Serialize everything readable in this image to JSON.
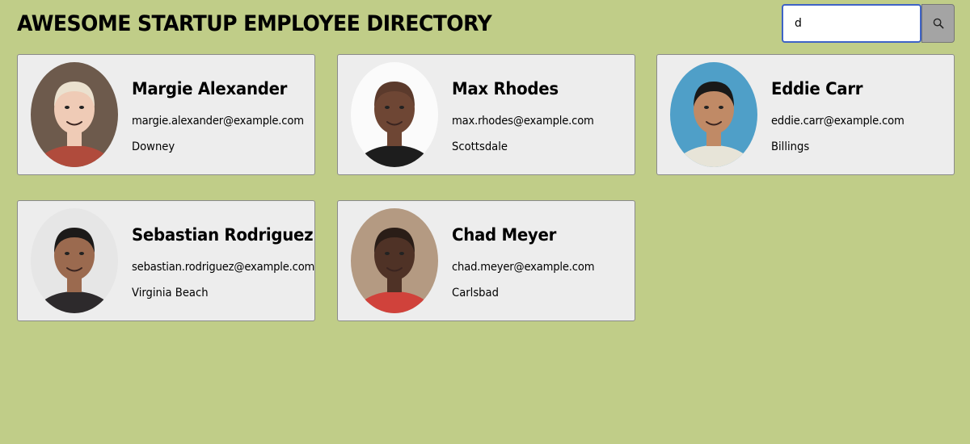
{
  "header": {
    "title": "AWESOME STARTUP EMPLOYEE DIRECTORY"
  },
  "search": {
    "value": "d",
    "button_icon": "search-icon"
  },
  "employees": [
    {
      "name": "Margie Alexander",
      "email": "margie.alexander@example.com",
      "city": "Downey",
      "avatar_bg": "#6d5a4c",
      "skin": "#efcbb6",
      "hair": "#ebe1cf",
      "shirt": "#b04b3c"
    },
    {
      "name": "Max Rhodes",
      "email": "max.rhodes@example.com",
      "city": "Scottsdale",
      "avatar_bg": "#fbfbfb",
      "skin": "#6e4634",
      "hair": "#5b3a2c",
      "shirt": "#1d1d1d"
    },
    {
      "name": "Eddie Carr",
      "email": "eddie.carr@example.com",
      "city": "Billings",
      "avatar_bg": "#4f9fc8",
      "skin": "#c08a66",
      "hair": "#191919",
      "shirt": "#e7e4d8"
    },
    {
      "name": "Sebastian Rodriguez",
      "email": "sebastian.rodriguez@example.com",
      "city": "Virginia Beach",
      "avatar_bg": "#e6e6e6",
      "skin": "#9b6a4f",
      "hair": "#1c1a19",
      "shirt": "#2d2a2c"
    },
    {
      "name": "Chad Meyer",
      "email": "chad.meyer@example.com",
      "city": "Carlsbad",
      "avatar_bg": "#b49a82",
      "skin": "#4f3226",
      "hair": "#2a1d17",
      "shirt": "#d0423b"
    }
  ]
}
